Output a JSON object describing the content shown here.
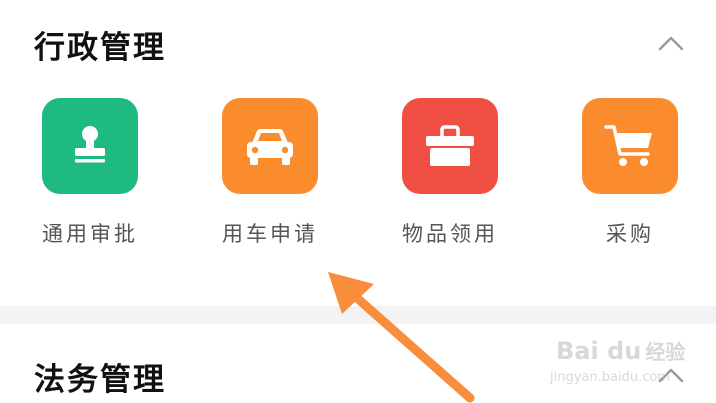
{
  "sections": [
    {
      "title": "行政管理",
      "items": [
        {
          "label": "通用审批",
          "icon": "stamp-icon",
          "color": "#1fba7f"
        },
        {
          "label": "用车申请",
          "icon": "car-icon",
          "color": "#fb8c2e"
        },
        {
          "label": "物品领用",
          "icon": "toolbox-icon",
          "color": "#f04f44"
        },
        {
          "label": "采购",
          "icon": "shopping-cart-icon",
          "color": "#fb8c2e"
        }
      ]
    },
    {
      "title": "法务管理"
    }
  ],
  "watermark": {
    "logo": "Bai du",
    "logo_cn": "经验",
    "url": "jingyan.baidu.com"
  },
  "colors": {
    "arrow": "#f98d3c",
    "section_gap": "#f3f3f5"
  }
}
